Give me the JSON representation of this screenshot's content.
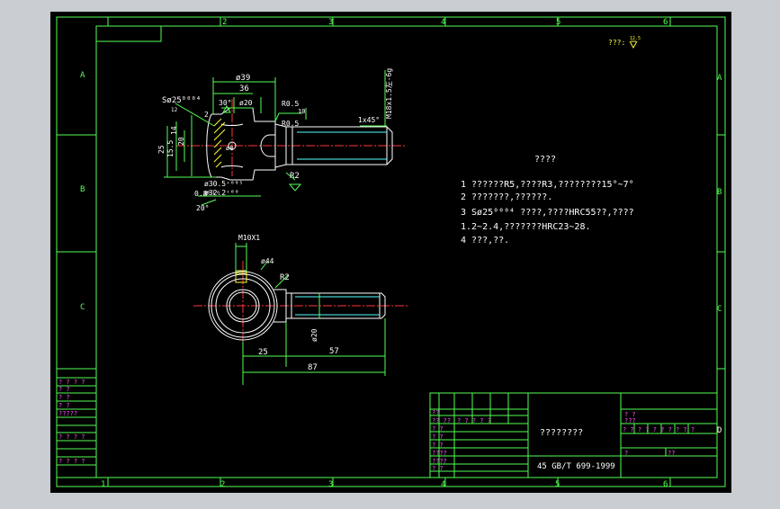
{
  "colors": {
    "window_bg": "#c9ccd1",
    "paper": "#000000",
    "frame": "#55ff55",
    "text": "#ffffff",
    "magenta": "#ff55ff",
    "cyan": "#55ffff",
    "red": "#ff3333",
    "yellow": "#ffff33"
  },
  "border": {
    "top_zones": [
      "1",
      "2",
      "3",
      "4",
      "5",
      "6"
    ],
    "bottom_zones": [
      "1",
      "2",
      "3",
      "4",
      "5",
      "6"
    ],
    "left_zones": [
      "A",
      "B",
      "C"
    ],
    "right_zones": [
      "A",
      "B",
      "C",
      "D"
    ]
  },
  "surface_roughness": {
    "label": "???:",
    "value": "12.5"
  },
  "front_view": {
    "dims": {
      "d39": "ø39",
      "d36": "36",
      "angle30": "30°",
      "d20": "ø20",
      "r05a": "R0.5",
      "d10": "10",
      "r05b": "R0.5",
      "chamfer": "1x45°",
      "thread": "M18x1.5左-6g",
      "sphere": "Sø25⁰⁰⁰⁴",
      "sphere_tol": "12",
      "d2": "2",
      "d14": "14",
      "d20b": "20",
      "d25": "25",
      "d155": "15.5",
      "d8": "ø8",
      "r2": "R2",
      "bore1": "ø30.5⁺⁰⁰⁵",
      "bore2": "ø32.2⁺⁰⁰",
      "d08": "0.8ʰ¹⁰",
      "angle20": "20°"
    }
  },
  "top_view": {
    "dims": {
      "m10": "M10X1",
      "d44": "ø44",
      "r2": "R2",
      "d20": "ø20",
      "d25": "25",
      "d57": "57",
      "d87": "87"
    }
  },
  "tech_requirements": {
    "title": "????",
    "lines": [
      "1  ??????R5,????R3,????????15°~7°",
      "2  ???????,??????.",
      "3  Sø25⁰⁰⁰⁴  ????,????HRC55??,????",
      "   1.2~2.4,???????HRC23~28.",
      "4  ???,??."
    ]
  },
  "left_table": {
    "header": "? ? ? ?",
    "rows": [
      "? ?",
      "? ?",
      "? ?",
      "?????",
      "",
      "? ? ? ?",
      "",
      "? ? ? ?"
    ]
  },
  "title_block": {
    "part_name": "????????",
    "material": "45 GB/T 699-1999",
    "left_rows": [
      "??",
      "?? ??",
      "? ?",
      "? ?",
      "? ?",
      "????",
      "????",
      "? ?"
    ],
    "sign_cols": "? ? ?     ? ?",
    "right_top": "? ?",
    "right_sub": "???",
    "right_scale": "? ? ? ?  ? ?  ? ?  ? ?",
    "right_d": "D",
    "sheet_a": "?",
    "sheet_b": "??"
  }
}
